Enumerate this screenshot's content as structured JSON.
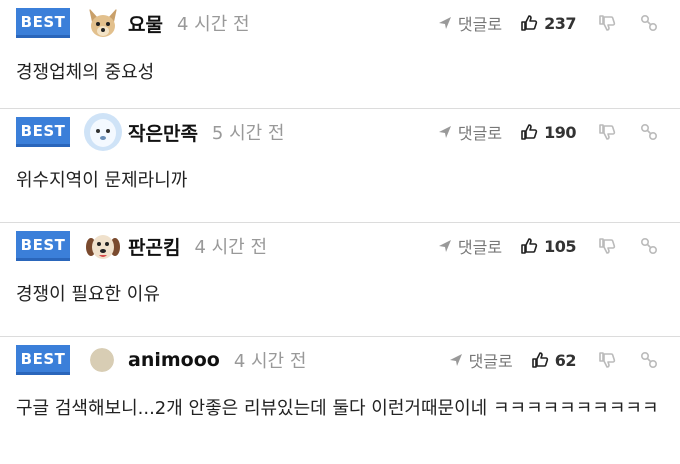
{
  "comments": [
    {
      "badge": "BEST",
      "nickname": "요물",
      "time": "4 시간 전",
      "reply_label": "댓글로",
      "likes": "237",
      "text": "경쟁업체의 중요성"
    },
    {
      "badge": "BEST",
      "nickname": "작은만족",
      "time": "5 시간 전",
      "reply_label": "댓글로",
      "likes": "190",
      "text": "위수지역이 문제라니까"
    },
    {
      "badge": "BEST",
      "nickname": "판곤킴",
      "time": "4 시간 전",
      "reply_label": "댓글로",
      "likes": "105",
      "text": "경쟁이 필요한 이유"
    },
    {
      "badge": "BEST",
      "nickname": "animooo",
      "time": "4 시간 전",
      "reply_label": "댓글로",
      "likes": "62",
      "text": "구글 검색해보니...2개 안좋은 리뷰있는데 둘다 이런거때문이네 ㅋㅋㅋㅋㅋㅋㅋㅋㅋㅋ"
    }
  ],
  "colors": {
    "badge": "#3b7fd9",
    "divider": "#dcdcdc",
    "muted": "#999999"
  },
  "icons": [
    "avatar-dog-icon",
    "avatar-snowman-icon",
    "avatar-puppy-icon",
    "avatar-circle-icon",
    "reply-arrow-icon",
    "thumbs-up-icon",
    "thumbs-down-icon",
    "link-icon"
  ]
}
